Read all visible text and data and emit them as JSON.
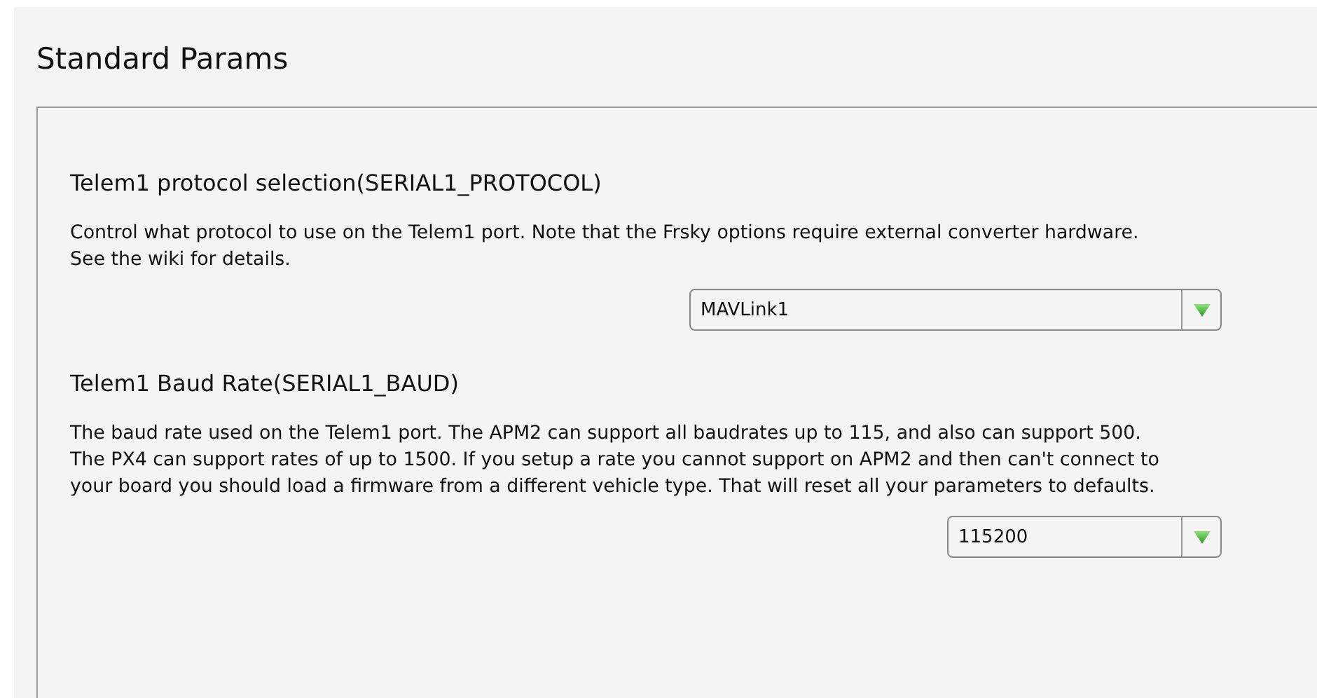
{
  "title": "Standard Params",
  "params": [
    {
      "name": "Telem1 protocol selection(SERIAL1_PROTOCOL)",
      "description": "Control what protocol to use on the Telem1 port. Note that the Frsky options require external converter hardware. See the wiki for details.",
      "value": "MAVLink1",
      "kind": "wide"
    },
    {
      "name": "Telem1 Baud Rate(SERIAL1_BAUD)",
      "description": "The baud rate used on the Telem1 port. The APM2 can support all baudrates up to 115, and also can support 500. The PX4 can support rates of up to 1500. If you setup a rate you cannot support on APM2 and then can't connect to your board you should load a firmware from a different vehicle type. That will reset all your parameters to defaults.",
      "value": "115200",
      "kind": "narrow"
    }
  ]
}
